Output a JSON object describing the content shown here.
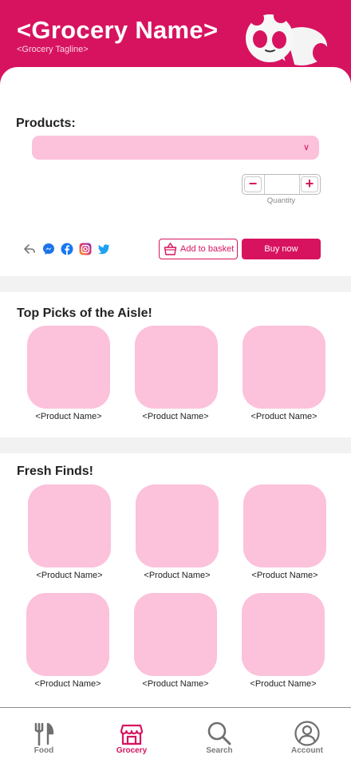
{
  "header": {
    "title": "<Grocery Name>",
    "tagline": "<Grocery Tagline>",
    "brand_color": "#d7135f"
  },
  "products": {
    "label": "Products:",
    "dropdown_value": "",
    "quantity_value": "",
    "quantity_label": "Quantity",
    "share_icons": [
      "share-icon",
      "messenger-icon",
      "facebook-icon",
      "instagram-icon",
      "twitter-icon"
    ],
    "add_to_basket_label": "Add to basket",
    "buy_now_label": "Buy now"
  },
  "top_picks": {
    "title": "Top Picks of the Aisle!",
    "items": [
      {
        "name": "<Product Name>"
      },
      {
        "name": "<Product Name>"
      },
      {
        "name": "<Product Name>"
      }
    ]
  },
  "fresh_finds": {
    "title": "Fresh Finds!",
    "items": [
      {
        "name": "<Product Name>"
      },
      {
        "name": "<Product Name>"
      },
      {
        "name": "<Product Name>"
      },
      {
        "name": "<Product Name>"
      },
      {
        "name": "<Product Name>"
      },
      {
        "name": "<Product Name>"
      }
    ]
  },
  "bottom_nav": {
    "items": [
      {
        "label": "Food",
        "icon": "fork-knife-icon",
        "active": false
      },
      {
        "label": "Grocery",
        "icon": "storefront-icon",
        "active": true
      },
      {
        "label": "Search",
        "icon": "search-icon",
        "active": false
      },
      {
        "label": "Account",
        "icon": "user-icon",
        "active": false
      }
    ],
    "active_color": "#d7135f",
    "inactive_color": "#7c7c7c"
  },
  "colors": {
    "placeholder_pink": "#fcc1db",
    "section_band": "#f2f2f2"
  }
}
